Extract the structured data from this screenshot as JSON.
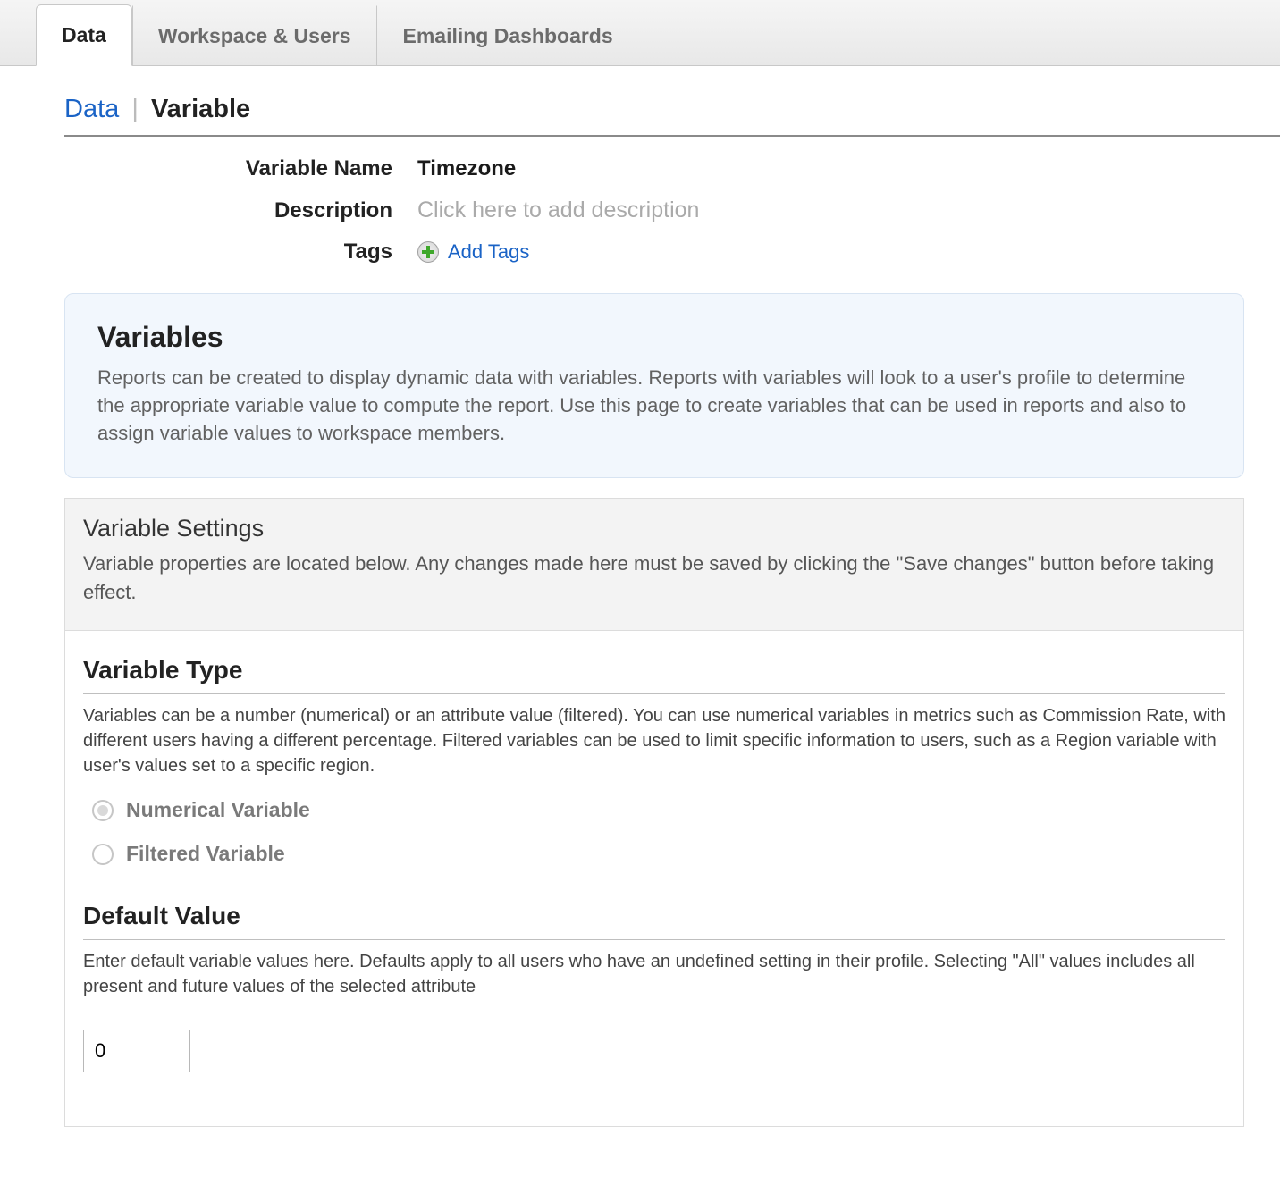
{
  "tabs": [
    {
      "label": "Data",
      "active": true
    },
    {
      "label": "Workspace & Users",
      "active": false
    },
    {
      "label": "Emailing Dashboards",
      "active": false
    }
  ],
  "breadcrumb": {
    "link": "Data",
    "current": "Variable"
  },
  "meta": {
    "name_label": "Variable Name",
    "name_value": "Timezone",
    "desc_label": "Description",
    "desc_placeholder": "Click here to add description",
    "tags_label": "Tags",
    "add_tags": "Add Tags"
  },
  "variables_intro": {
    "title": "Variables",
    "body": "Reports can be created to display dynamic data with variables. Reports with variables will look to a user's profile to determine the appropriate variable value to compute the report. Use this page to create variables that can be used in reports and also to assign variable values to workspace members."
  },
  "settings_intro": {
    "title": "Variable Settings",
    "body": "Variable properties are located below. Any changes made here must be saved by clicking the \"Save changes\" button before taking effect."
  },
  "type_section": {
    "title": "Variable Type",
    "body": "Variables can be a number (numerical) or an attribute value (filtered). You can use numerical variables in metrics such as Commission Rate, with different users having a different percentage. Filtered variables can be used to limit specific information to users, such as a Region variable with user's values set to a specific region.",
    "options": [
      {
        "label": "Numerical Variable",
        "checked": true
      },
      {
        "label": "Filtered Variable",
        "checked": false
      }
    ]
  },
  "default_section": {
    "title": "Default Value",
    "body": "Enter default variable values here. Defaults apply to all users who have an undefined setting in their profile. Selecting \"All\" values includes all present and future values of the selected attribute",
    "value": "0"
  }
}
